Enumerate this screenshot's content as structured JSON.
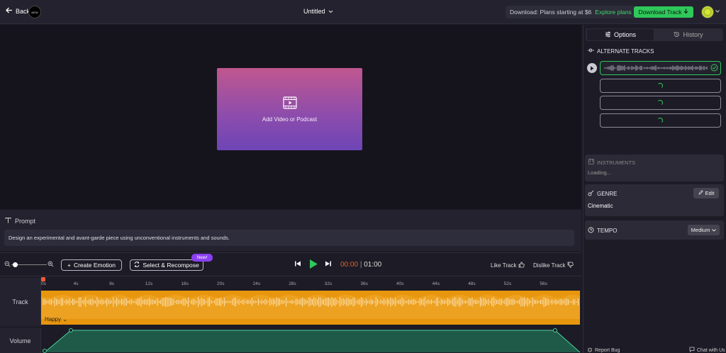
{
  "topbar": {
    "back_label": "Back",
    "logo_text": "NEW",
    "project_title": "Untitled",
    "plan_text": "Download: Plans starting at $6",
    "plan_link": "Explore plans",
    "download_label": "Download Track"
  },
  "preview": {
    "add_video_label": "Add Video or Podcast"
  },
  "prompt": {
    "title": "Prompt",
    "text": "Design an experimental and avant-garde piece using unconventional instruments and sounds."
  },
  "toolbar": {
    "create_emotion_label": "Create Emotion",
    "select_recompose_label": "Select & Recompose",
    "new_badge": "New!",
    "time_current": "00:00",
    "time_separator": "|",
    "time_total": "01:00",
    "like_label": "Like Track",
    "dislike_label": "Dislike Track"
  },
  "timeline": {
    "ticks": [
      "0s",
      "4s",
      "8s",
      "12s",
      "16s",
      "20s",
      "24s",
      "28s",
      "32s",
      "36s",
      "40s",
      "44s",
      "48s",
      "52s",
      "56s"
    ],
    "track_label": "Track",
    "mood_label": "Happy",
    "volume_label": "Volume"
  },
  "panel": {
    "tab_options": "Options",
    "tab_history": "History",
    "alternate_tracks_title": "ALTERNATE TRACKS",
    "instruments_title": "INSTRUMENTS",
    "instruments_status": "Loading...",
    "genre_title": "GENRE",
    "genre_edit": "Edit",
    "genre_value": "Cinematic",
    "tempo_title": "TEMPO",
    "tempo_value": "Medium",
    "report_bug": "Report Bug",
    "chat": "Chat with Us"
  },
  "colors": {
    "accent_green": "#2fc85a",
    "track_orange": "#e8960e",
    "time_orange": "#e0602a",
    "badge_purple": "#8b3ff2"
  }
}
